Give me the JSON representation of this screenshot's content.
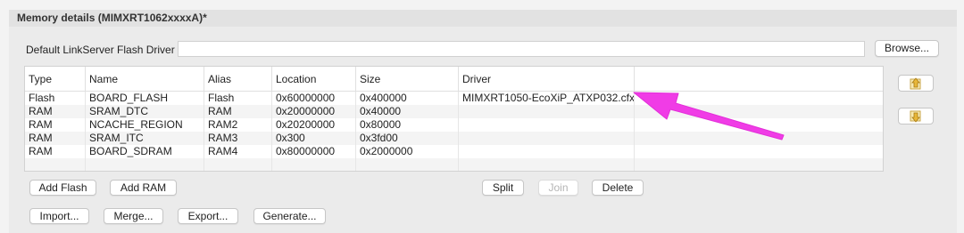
{
  "section_title": "Memory details (MIMXRT1062xxxxA)*",
  "flash_driver": {
    "label": "Default LinkServer Flash Driver",
    "value": "",
    "browse_label": "Browse..."
  },
  "table": {
    "columns": [
      "Type",
      "Name",
      "Alias",
      "Location",
      "Size",
      "Driver"
    ],
    "rows": [
      [
        "Flash",
        "BOARD_FLASH",
        "Flash",
        "0x60000000",
        "0x400000",
        "MIMXRT1050-EcoXiP_ATXP032.cfx"
      ],
      [
        "RAM",
        "SRAM_DTC",
        "RAM",
        "0x20000000",
        "0x40000",
        ""
      ],
      [
        "RAM",
        "NCACHE_REGION",
        "RAM2",
        "0x20200000",
        "0x80000",
        ""
      ],
      [
        "RAM",
        "SRAM_ITC",
        "RAM3",
        "0x300",
        "0x3fd00",
        ""
      ],
      [
        "RAM",
        "BOARD_SDRAM",
        "RAM4",
        "0x80000000",
        "0x2000000",
        ""
      ]
    ]
  },
  "buttons": {
    "add_flash": "Add Flash",
    "add_ram": "Add RAM",
    "split": "Split",
    "join": "Join",
    "delete": "Delete",
    "import": "Import...",
    "merge": "Merge...",
    "export": "Export...",
    "generate": "Generate..."
  },
  "side_icons": [
    "move-up-icon",
    "move-down-icon"
  ],
  "annotation": {
    "arrow_color": "#f03ce6"
  }
}
